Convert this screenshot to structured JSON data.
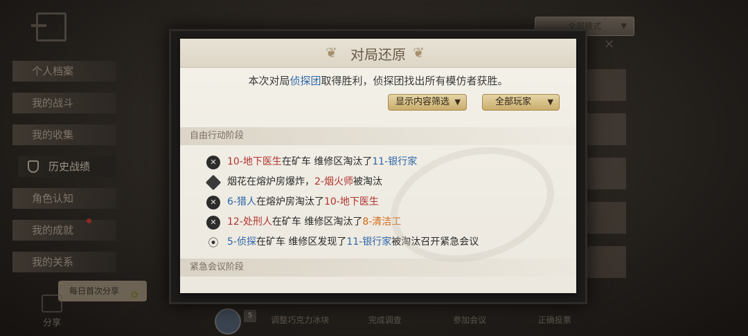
{
  "side_menu": {
    "items": [
      {
        "label": "个人档案"
      },
      {
        "label": "我的战斗"
      },
      {
        "label": "我的收集"
      },
      {
        "label": "历史战绩"
      },
      {
        "label": "角色认知"
      },
      {
        "label": "我的成就"
      },
      {
        "label": "我的关系"
      }
    ]
  },
  "share": {
    "tag": "每日首次分享",
    "label": "分享"
  },
  "mode_dropdown": {
    "label": "全部模式"
  },
  "bottom_bar": {
    "badge": "5",
    "items": [
      "调整巧克力冰块",
      "完成调查",
      "参加会议",
      "正确投票"
    ]
  },
  "modal": {
    "title": "对局还原",
    "summary_prefix": "本次对局",
    "summary_team": "侦探团",
    "summary_suffix": "取得胜利，侦探团找出所有模仿者获胜。",
    "filter_content": "显示内容筛选",
    "filter_players": "全部玩家",
    "phase1": "自由行动阶段",
    "phase2": "紧急会议阶段",
    "events": [
      {
        "icon": "skull-icon",
        "parts": [
          [
            "red",
            "10-地下医生"
          ],
          [
            "",
            "在矿车 维修区淘汰了"
          ],
          [
            "blue",
            "11-银行家"
          ]
        ]
      },
      {
        "icon": "firework-icon",
        "parts": [
          [
            "",
            "烟花在熔炉房爆炸，"
          ],
          [
            "red",
            "2-烟火师"
          ],
          [
            "",
            "被淘汰"
          ]
        ]
      },
      {
        "icon": "skull-icon",
        "parts": [
          [
            "blue",
            "6-猎人"
          ],
          [
            "",
            "在熔炉房淘汰了"
          ],
          [
            "red",
            "10-地下医生"
          ]
        ]
      },
      {
        "icon": "skull-icon",
        "parts": [
          [
            "red",
            "12-处刑人"
          ],
          [
            "",
            "在矿车 维修区淘汰了"
          ],
          [
            "orange",
            "8-清洁工"
          ]
        ]
      },
      {
        "icon": "signal-icon",
        "parts": [
          [
            "blue",
            "5-侦探"
          ],
          [
            "",
            "在矿车 维修区发现了"
          ],
          [
            "blue",
            "11-银行家"
          ],
          [
            "",
            "被淘汰召开紧急会议"
          ]
        ]
      }
    ]
  }
}
